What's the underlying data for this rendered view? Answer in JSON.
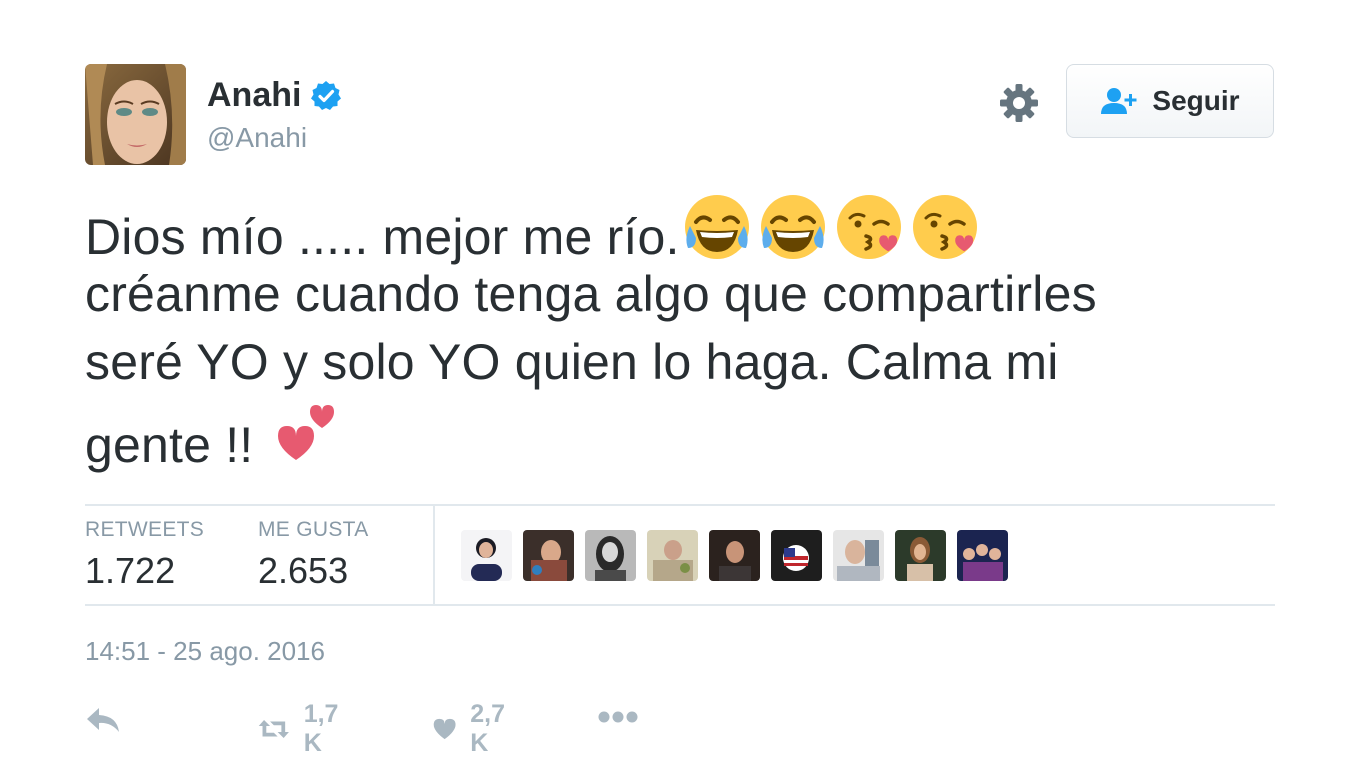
{
  "user": {
    "name": "Anahi",
    "handle": "@Anahi",
    "verified": true,
    "avatar": "profile-photo"
  },
  "header": {
    "settings_icon": "gear-icon",
    "follow_label": "Seguir",
    "follow_icon": "add-user-icon"
  },
  "tweet": {
    "lines": [
      "Dios mío ..... mejor me río.",
      "créanme cuando tenga algo que compartirles",
      "seré YO y solo YO quien lo haga.  Calma mi",
      "gente !!"
    ],
    "emojis_line1": [
      "face-with-tears-of-joy",
      "face-with-tears-of-joy",
      "face-throwing-a-kiss",
      "face-throwing-a-kiss"
    ],
    "emoji_line4": "two-hearts"
  },
  "stats": {
    "retweets_label": "RETWEETS",
    "retweets_value": "1.722",
    "likes_label": "ME GUSTA",
    "likes_value": "2.653",
    "likers": [
      "liker-avatar-1",
      "liker-avatar-2",
      "liker-avatar-3",
      "liker-avatar-4",
      "liker-avatar-5",
      "liker-avatar-6",
      "liker-avatar-7",
      "liker-avatar-8",
      "liker-avatar-9"
    ]
  },
  "timestamp": "14:51 - 25 ago. 2016",
  "actions": {
    "reply_icon": "reply-icon",
    "retweet_icon": "retweet-icon",
    "retweet_count": "1,7 K",
    "like_icon": "heart-icon",
    "like_count": "2,7 K",
    "more_icon": "more-dots-icon"
  },
  "colors": {
    "text": "#292f33",
    "muted": "#8899a6",
    "action": "#aab8c2",
    "accent": "#1da1f2",
    "border": "#e1e8ed"
  }
}
